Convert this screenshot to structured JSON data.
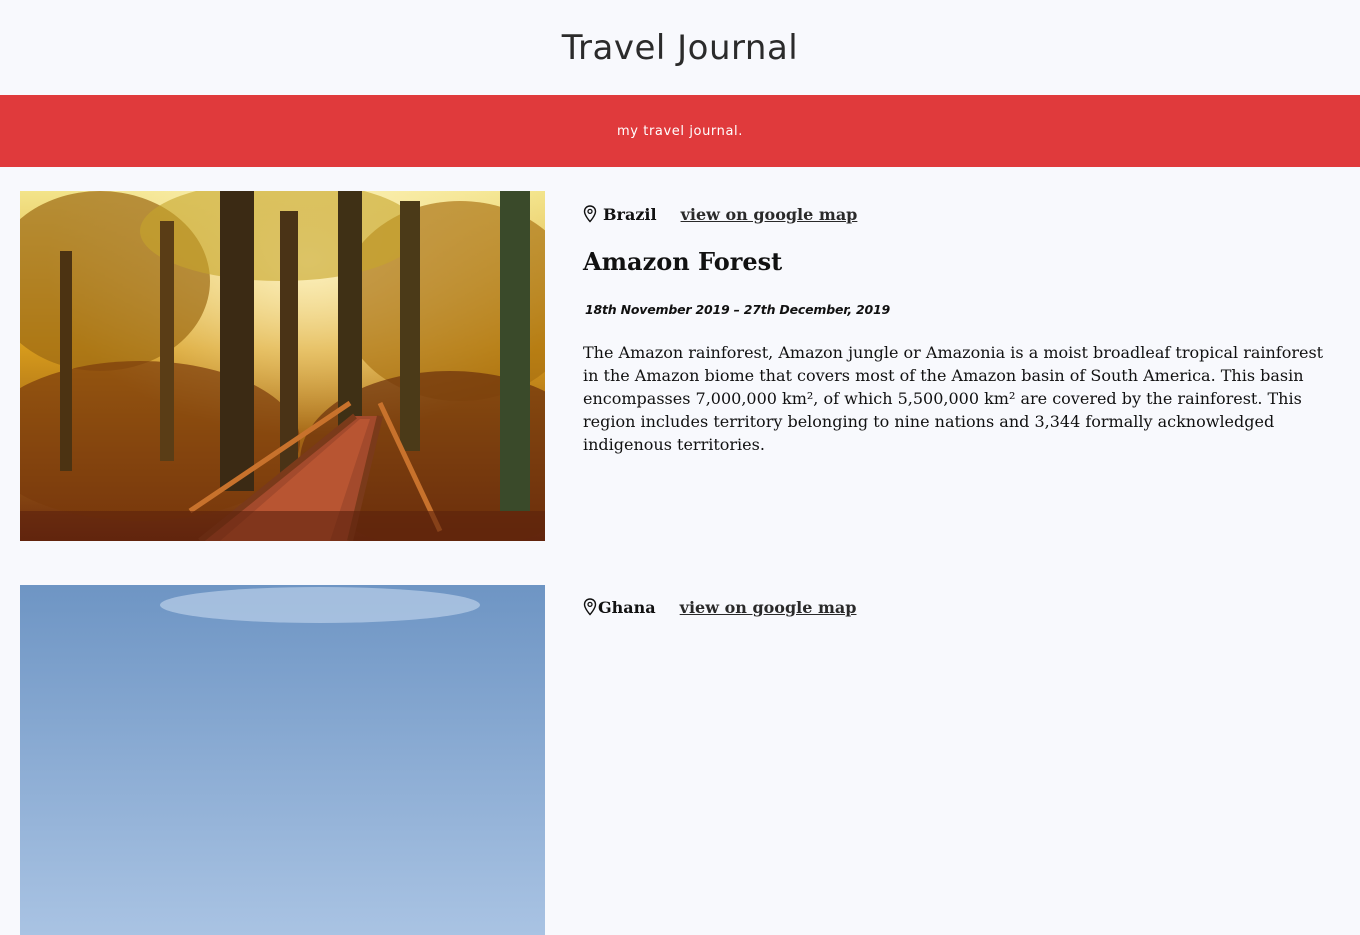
{
  "header": {
    "title": "Travel Journal"
  },
  "banner": {
    "text": "my travel journal."
  },
  "entries": [
    {
      "country": "Brazil",
      "map_link_label": "view on google map",
      "title": "Amazon Forest",
      "dates": "18th November 2019 – 27th December, 2019",
      "description": "The Amazon rainforest, Amazon jungle or Amazonia is a moist broadleaf tropical rainforest in the Amazon biome that covers most of the Amazon basin of South America. This basin encompasses 7,000,000 km², of which 5,500,000 km² are covered by the rainforest. This region includes territory belonging to nine nations and 3,344 formally acknowledged indigenous territories.",
      "icon": "map-pin-icon"
    },
    {
      "country": "Ghana",
      "map_link_label": "view on google map",
      "icon": "map-pin-icon"
    }
  ],
  "colors": {
    "banner": "#e03a3c",
    "background": "#f8f9fd"
  }
}
